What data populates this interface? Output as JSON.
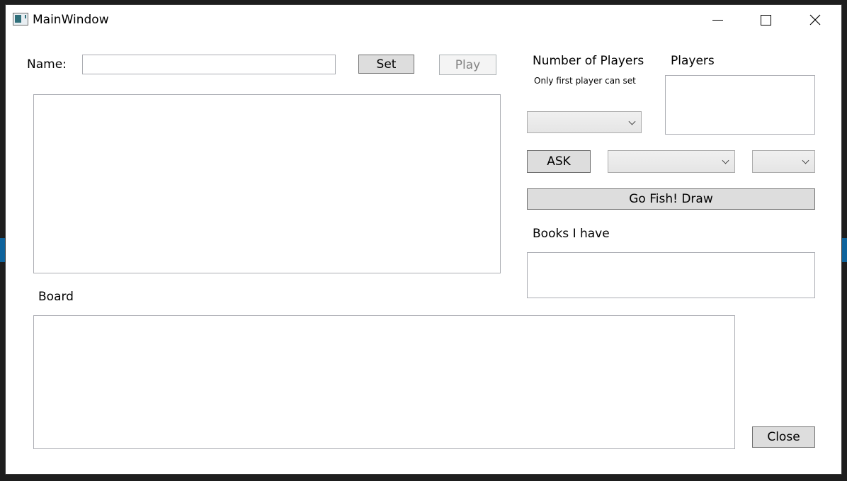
{
  "window": {
    "title": "MainWindow",
    "controls": {
      "minimize": "minimize-icon",
      "maximize": "maximize-icon",
      "close": "close-icon"
    }
  },
  "name_row": {
    "label": "Name:",
    "value": "",
    "set_label": "Set",
    "play_label": "Play"
  },
  "players": {
    "number_label": "Number of Players",
    "note": "Only first player can set",
    "selected": "",
    "list_label": "Players",
    "items": []
  },
  "ask": {
    "button_label": "ASK",
    "player_selected": "",
    "rank_selected": ""
  },
  "draw_label": "Go Fish! Draw",
  "books": {
    "label": "Books I have",
    "items": []
  },
  "board": {
    "label": "Board",
    "content": ""
  },
  "close_label": "Close",
  "colors": {
    "window_bg": "#ffffff",
    "button_bg": "#dddddd",
    "border": "#abadb3",
    "backdrop": "#1e1e1e"
  }
}
